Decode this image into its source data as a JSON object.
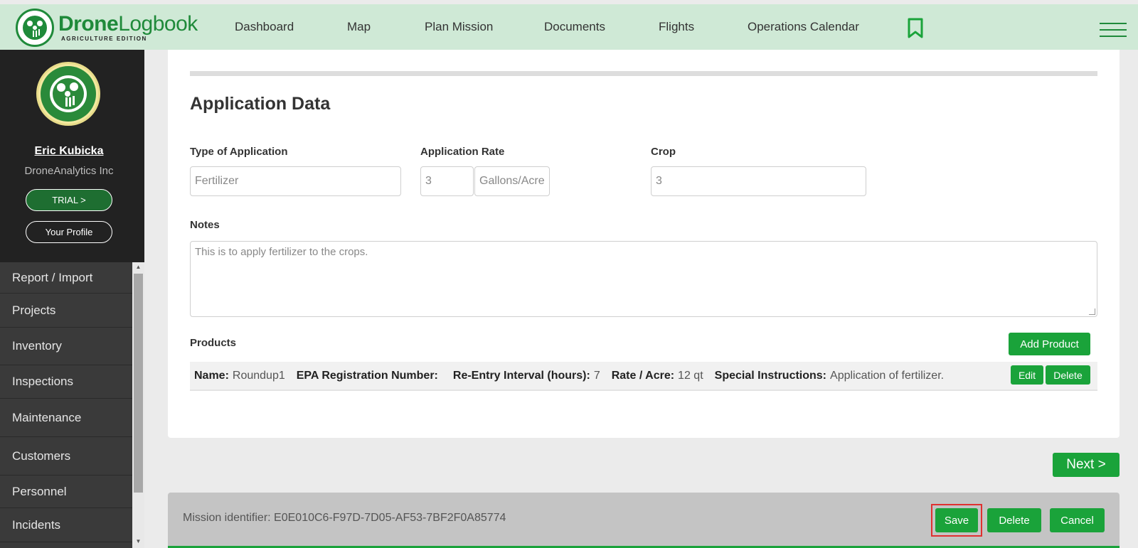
{
  "header": {
    "logo_main_bold": "Drone",
    "logo_main_light": "Logbook",
    "logo_sub": "AGRICULTURE EDITION",
    "nav": [
      "Dashboard",
      "Map",
      "Plan Mission",
      "Documents",
      "Flights",
      "Operations Calendar"
    ]
  },
  "sidebar": {
    "user_name": "Eric Kubicka",
    "company": "DroneAnalytics Inc",
    "trial_label": "TRIAL >",
    "profile_label": "Your Profile",
    "items": [
      "Report / Import",
      "Projects",
      "Inventory",
      "Inspections",
      "Maintenance",
      "Customers",
      "Personnel",
      "Incidents"
    ]
  },
  "application": {
    "title": "Application Data",
    "type_label": "Type of Application",
    "type_value": "Fertilizer",
    "rate_label": "Application Rate",
    "rate_value": "3",
    "rate_unit": "Gallons/Acre",
    "crop_label": "Crop",
    "crop_value": "3",
    "notes_label": "Notes",
    "notes_value": "This is to apply fertilizer to the crops."
  },
  "products": {
    "label": "Products",
    "add_label": "Add Product",
    "rows": [
      {
        "name_label": "Name:",
        "name": "Roundup1",
        "epa_label": "EPA Registration Number:",
        "epa": "",
        "reentry_label": "Re-Entry Interval (hours):",
        "reentry": "7",
        "rate_label": "Rate / Acre:",
        "rate": "12 qt",
        "instructions_label": "Special Instructions:",
        "instructions": "Application of fertilizer.",
        "edit_label": "Edit",
        "delete_label": "Delete"
      }
    ]
  },
  "next_label": "Next >",
  "footer": {
    "mission_id": "Mission identifier: E0E010C6-F97D-7D05-AF53-7BF2F0A85774",
    "save_label": "Save",
    "delete_label": "Delete",
    "cancel_label": "Cancel"
  },
  "colors": {
    "accent": "#1aa33a",
    "nav_bg": "#cfe9d6",
    "sidebar_bg": "#222222",
    "highlight": "#e03030"
  }
}
